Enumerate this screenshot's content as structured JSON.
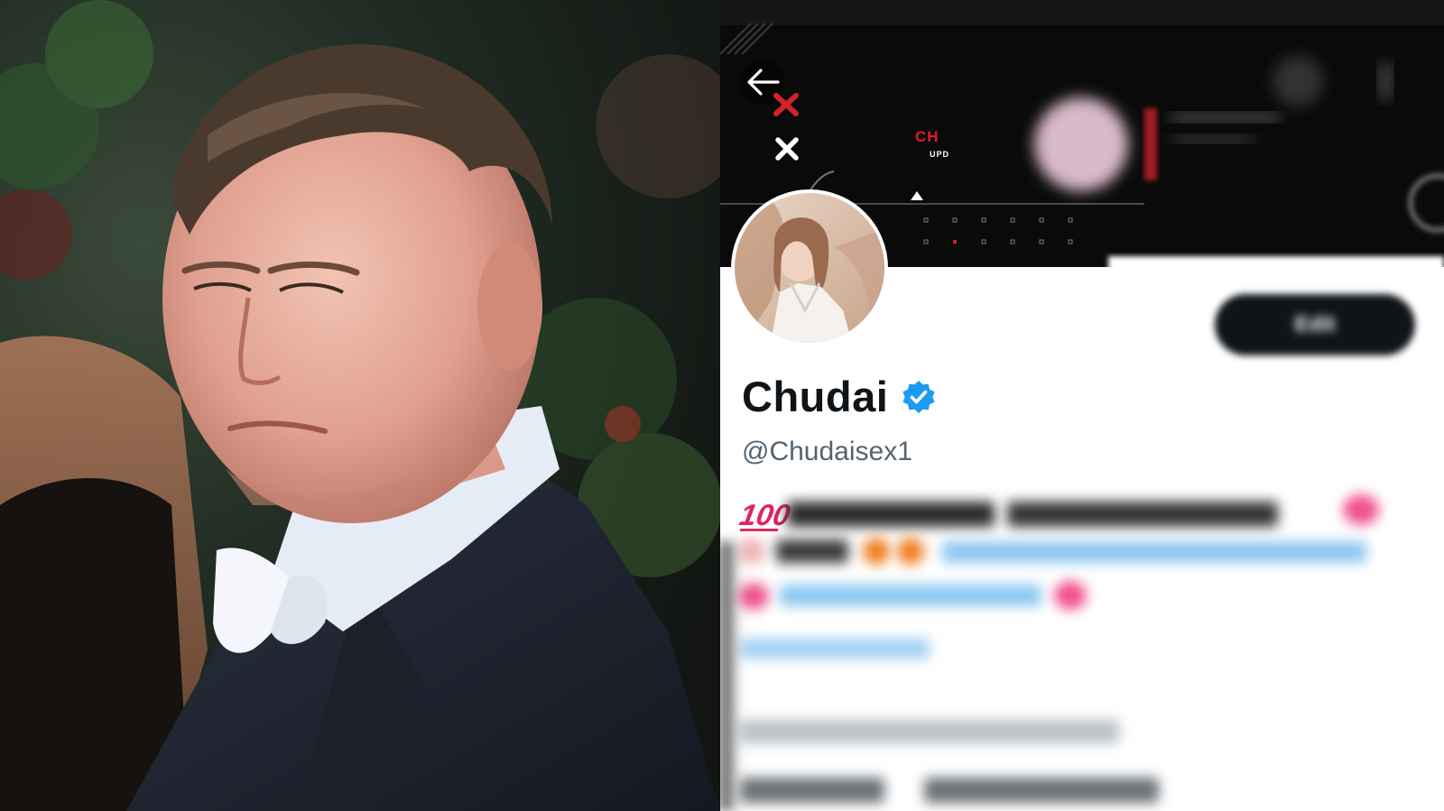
{
  "profile": {
    "display_name": "Chudai",
    "handle": "@Chudaisex1",
    "bio_emoji": "100",
    "edit_button_label": "Edit"
  },
  "banner": {
    "title": "CH",
    "subtitle": "UPD"
  },
  "colors": {
    "banner_bg": "#0a0a0a",
    "brand_red": "#e21b2a",
    "verified_blue": "#1d9bf0",
    "name_text": "#0f1419",
    "handle_text": "#536471",
    "link_blue": "#1d9bf0",
    "pink_heart": "#f0508c"
  },
  "icons": {
    "back": "arrow-left-icon",
    "verified": "verified-badge-icon",
    "close": "close-icon"
  }
}
